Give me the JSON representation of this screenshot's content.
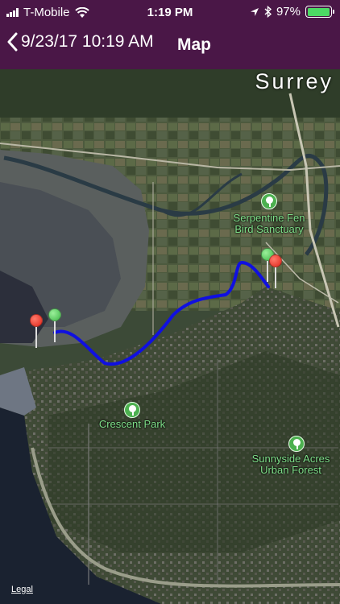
{
  "status": {
    "carrier": "T-Mobile",
    "time": "1:19 PM",
    "battery": "97%",
    "battery_level": 0.97
  },
  "nav": {
    "back_label": "9/23/17 10:19 AM",
    "title": "Map"
  },
  "map": {
    "city_label": "Surrey",
    "places": [
      {
        "name": "Serpentine Fen\nBird Sanctuary"
      },
      {
        "name": "Crescent Park"
      },
      {
        "name": "Sunnyside Acres\nUrban Forest"
      }
    ],
    "route_color": "#1010e0",
    "legal": "Legal"
  },
  "colors": {
    "bar": "#4a1747",
    "pin_start": "#3fb548",
    "pin_end": "#e0251a"
  }
}
